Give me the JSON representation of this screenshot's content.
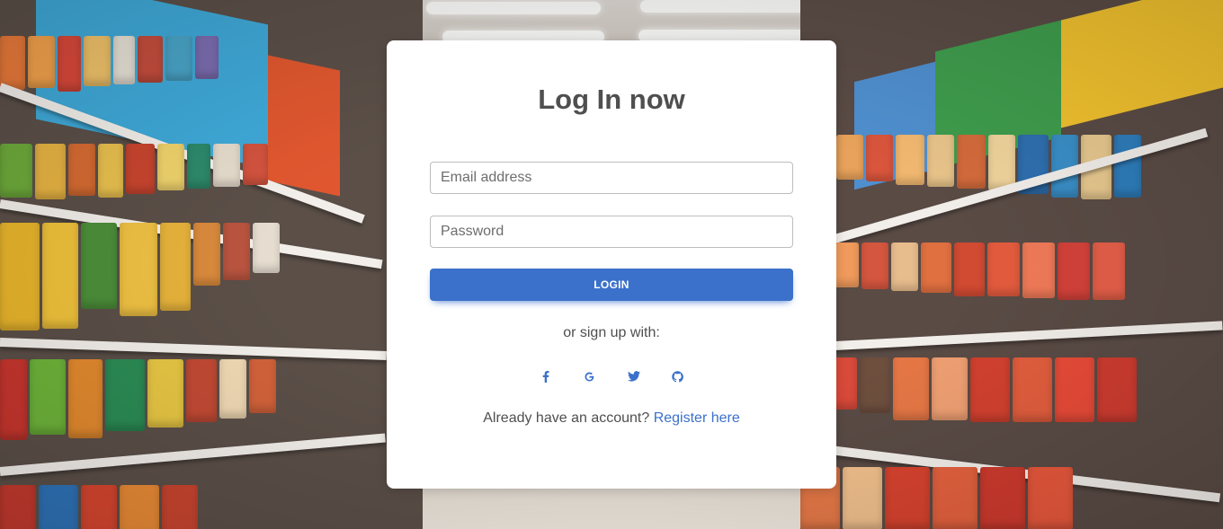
{
  "login": {
    "title": "Log In now",
    "email_placeholder": "Email address",
    "password_placeholder": "Password",
    "login_label": "LOGIN",
    "or_text": "or sign up with:",
    "socials": [
      {
        "name": "facebook-icon"
      },
      {
        "name": "google-icon"
      },
      {
        "name": "twitter-icon"
      },
      {
        "name": "github-icon"
      }
    ],
    "account_text": "Already have an account?",
    "register_label": "Register here"
  },
  "colors": {
    "accent": "#3b71ca",
    "text": "#4f4f4f",
    "card_background": "#ffffff"
  }
}
